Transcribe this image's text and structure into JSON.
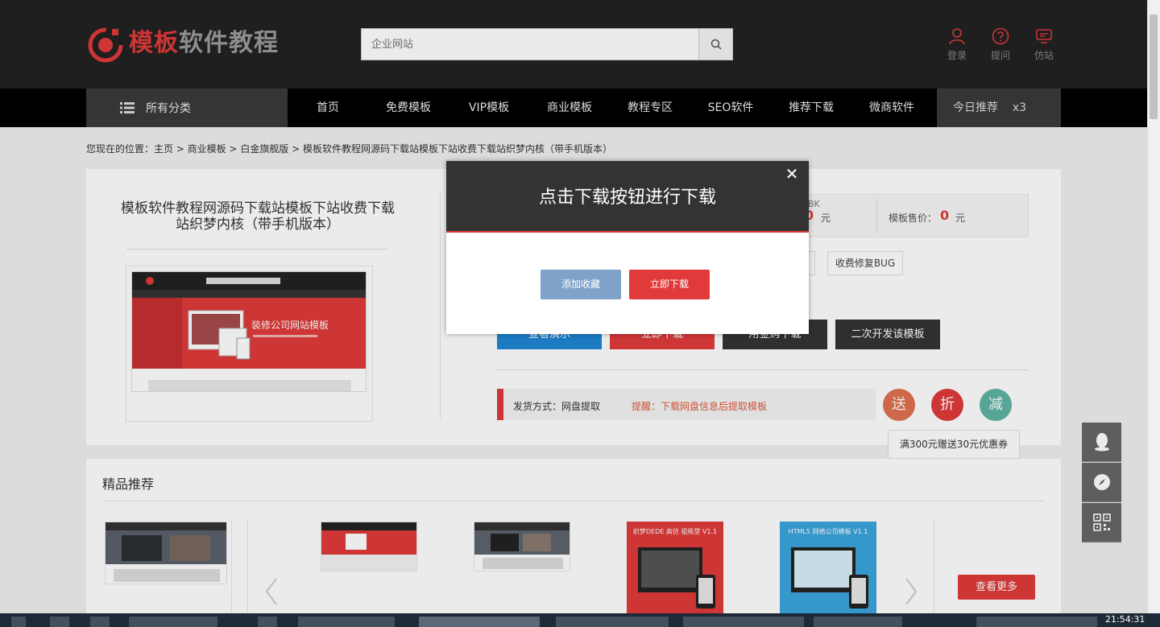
{
  "header": {
    "logo_red": "模板",
    "logo_gray": "软件教程",
    "search_placeholder": "企业网站",
    "links": [
      {
        "label": "登录",
        "icon": "user-icon"
      },
      {
        "label": "提问",
        "icon": "question-icon"
      },
      {
        "label": "仿站",
        "icon": "monitor-icon"
      }
    ]
  },
  "nav": {
    "all_categories": "所有分类",
    "items": [
      "首页",
      "免费模板",
      "VIP模板",
      "商业模板",
      "教程专区",
      "SEO软件",
      "推荐下载",
      "微商软件"
    ],
    "today": "今日推荐",
    "today_count": "x3"
  },
  "breadcrumb": "您现在的位置：主页 > 商业模板 > 白金旗舰版 > 模板软件教程网源码下载站模板下站收费下载站织梦内核（带手机版本）",
  "product": {
    "title": "模板软件教程网源码下载站模板下站收费下载站织梦内核（带手机版本）",
    "thumb_banner": "装修公司网站模板",
    "size_fragment": "BK",
    "price_label": "模板售价：",
    "price_value": "0",
    "price_unit": "元",
    "tags": [
      "收费修复BUG"
    ],
    "actions": [
      "查看演示",
      "立即下载",
      "用金购下载",
      "二次开发该模板"
    ],
    "ship_label": "发货方式：网盘提取",
    "ship_remind": "提醒：下载网盘信息后提取模板",
    "promos": [
      {
        "label": "送",
        "color": "#e0714f"
      },
      {
        "label": "折",
        "color": "#e03a3a"
      },
      {
        "label": "减",
        "color": "#5fb3a3"
      }
    ],
    "promo_tip": "满300元赠送30元优惠券"
  },
  "recommend": {
    "title": "精品推荐",
    "more": "查看更多",
    "thumb_captions": [
      "",
      "",
      "",
      "织梦DEDE 高仿 祖瓶堂 V1.1",
      "HTML5 网络公司模板 V1.1"
    ]
  },
  "modal": {
    "title": "点击下载按钮进行下载",
    "close": "✕",
    "fav_button": "添加收藏",
    "download_button": "立即下载"
  },
  "taskbar": {
    "clock": "21:54:31"
  },
  "colors": {
    "brand_red": "#e03a3a",
    "header_bg": "#222222",
    "nav_bg": "#000000"
  }
}
